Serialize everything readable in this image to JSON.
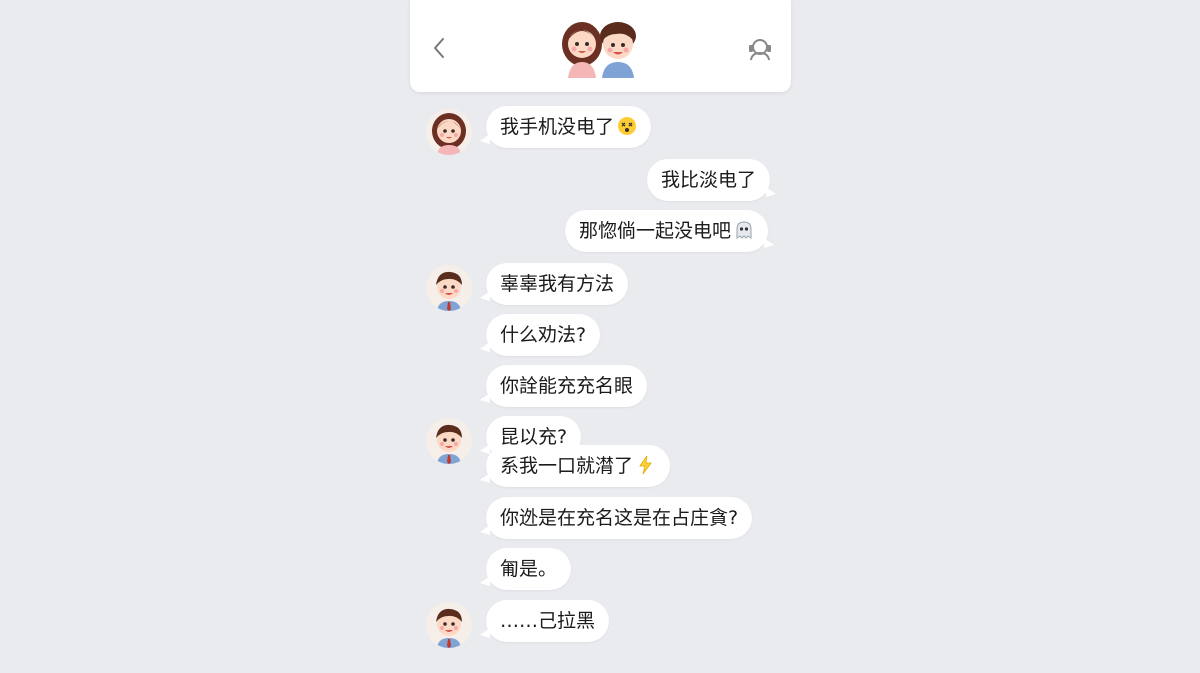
{
  "header": {
    "back_icon": "chevron-left-icon",
    "avatar_icon": "couple-avatar-icon",
    "contact_icon": "contact-icon"
  },
  "messages": [
    {
      "text": "我手机没电了",
      "side": "left",
      "sender": "girl",
      "emoji": "dizzy-face-emoji"
    },
    {
      "text": "我比淡电了",
      "side": "right"
    },
    {
      "text": "那惚倘一起没电吧",
      "side": "right",
      "emoji": "ghost-emoji"
    },
    {
      "text": "辜辜我有方法",
      "side": "left",
      "sender": "boy"
    },
    {
      "text": "什么劝法?",
      "side": "left"
    },
    {
      "text": "你詮能充充名眼",
      "side": "left"
    },
    {
      "text": "昆以充?",
      "side": "left",
      "sender": "boy"
    },
    {
      "text": "系我一口就潸了",
      "side": "left",
      "emoji": "lightning-emoji"
    },
    {
      "text": "你迯是在充名这是在占庄貪?",
      "side": "left"
    },
    {
      "text": "匍是。",
      "side": "left"
    },
    {
      "text": "……己拉黑",
      "side": "left",
      "sender": "boy"
    }
  ],
  "colors": {
    "background": "#e9ebef",
    "bubble": "#ffffff",
    "text": "#1b1b1b"
  }
}
